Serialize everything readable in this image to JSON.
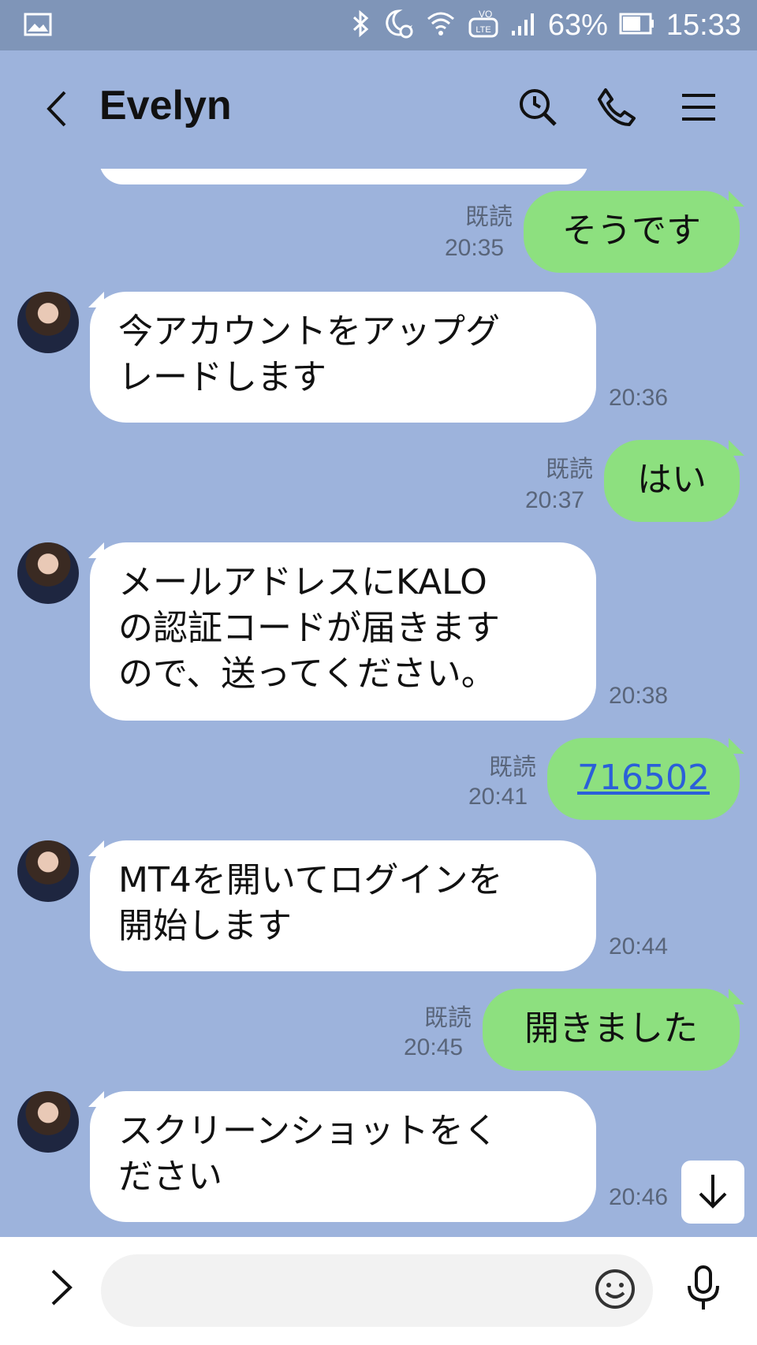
{
  "status_bar": {
    "battery": "63%",
    "time": "15:33",
    "icons": [
      "gallery-icon",
      "bluetooth-icon",
      "alarm-moon-icon",
      "wifi-icon",
      "volte-icon",
      "signal-icon",
      "battery-icon"
    ]
  },
  "header": {
    "title": "Evelyn",
    "icons": [
      "back-icon",
      "search-icon",
      "phone-icon",
      "menu-icon"
    ]
  },
  "messages": [
    {
      "direction": "out",
      "text": "そうです",
      "read": "既読",
      "time": "20:35"
    },
    {
      "direction": "in",
      "lines": [
        "今アカウントをアップグ",
        "レードします"
      ],
      "time": "20:36"
    },
    {
      "direction": "out",
      "text": "はい",
      "read": "既読",
      "time": "20:37"
    },
    {
      "direction": "in",
      "lines": [
        "メールアドレスにKALO",
        "の認証コードが届きます",
        "ので、送ってください。"
      ],
      "time": "20:38"
    },
    {
      "direction": "out",
      "text": "716502",
      "link": true,
      "read": "既読",
      "time": "20:41"
    },
    {
      "direction": "in",
      "lines": [
        "MT4を開いてログインを",
        "開始します"
      ],
      "time": "20:44"
    },
    {
      "direction": "out",
      "text": "開きました",
      "read": "既読",
      "time": "20:45"
    },
    {
      "direction": "in",
      "lines": [
        "スクリーンショットをく",
        "ださい"
      ],
      "time": "20:46"
    }
  ],
  "input": {
    "placeholder": ""
  },
  "colors": {
    "background": "#9db3dc",
    "outgoing_bubble": "#8de07f",
    "incoming_bubble": "#ffffff",
    "link": "#2b5fd9"
  }
}
